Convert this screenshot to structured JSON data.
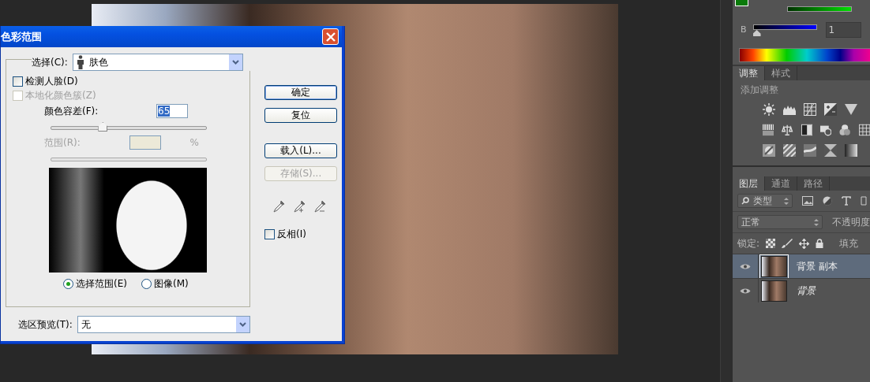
{
  "dialog": {
    "title": "色彩范围",
    "select": {
      "label": "选择(C):",
      "value": "肤色"
    },
    "checkboxes": [
      {
        "label": "检测人脸(D)",
        "checked": false,
        "disabled": false
      },
      {
        "label": "本地化颜色簇(Z)",
        "checked": false,
        "disabled": true
      }
    ],
    "fuzziness": {
      "label": "颜色容差(F):",
      "value": "65",
      "level": 0.33
    },
    "range": {
      "label": "范围(R):",
      "unit": "%",
      "disabled": true
    },
    "preview_options": [
      {
        "label": "选择范围(E)",
        "selected": true
      },
      {
        "label": "图像(M)",
        "selected": false
      }
    ],
    "selection_preview": {
      "label": "选区预览(T):",
      "value": "无"
    },
    "buttons": [
      {
        "label": "确定",
        "default": true,
        "disabled": false
      },
      {
        "label": "复位",
        "default": false,
        "disabled": false
      },
      {
        "label": "载入(L)...",
        "default": false,
        "disabled": false
      },
      {
        "label": "存储(S)...",
        "default": false,
        "disabled": true
      }
    ],
    "invert": {
      "label": "反相(I)",
      "checked": false
    }
  },
  "color_panel": {
    "channel": {
      "label": "B",
      "value": "1",
      "level": 0.0
    }
  },
  "adjustments_panel": {
    "tabs": [
      {
        "label": "调整",
        "selected": true
      },
      {
        "label": "样式",
        "selected": false
      }
    ],
    "heading": "添加调整"
  },
  "layers_panel": {
    "tabs": [
      {
        "label": "图层",
        "selected": true
      },
      {
        "label": "通道",
        "selected": false
      },
      {
        "label": "路径",
        "selected": false
      }
    ],
    "filter": "类型",
    "blend_mode": "正常",
    "opacity_label": "不透明度",
    "lock_label": "锁定:",
    "fill_label": "填充",
    "layers": [
      {
        "name": "背景 副本",
        "kind": "layer",
        "selected": true,
        "visible": true
      },
      {
        "name": "背景",
        "kind": "background",
        "selected": false,
        "visible": true
      }
    ]
  }
}
